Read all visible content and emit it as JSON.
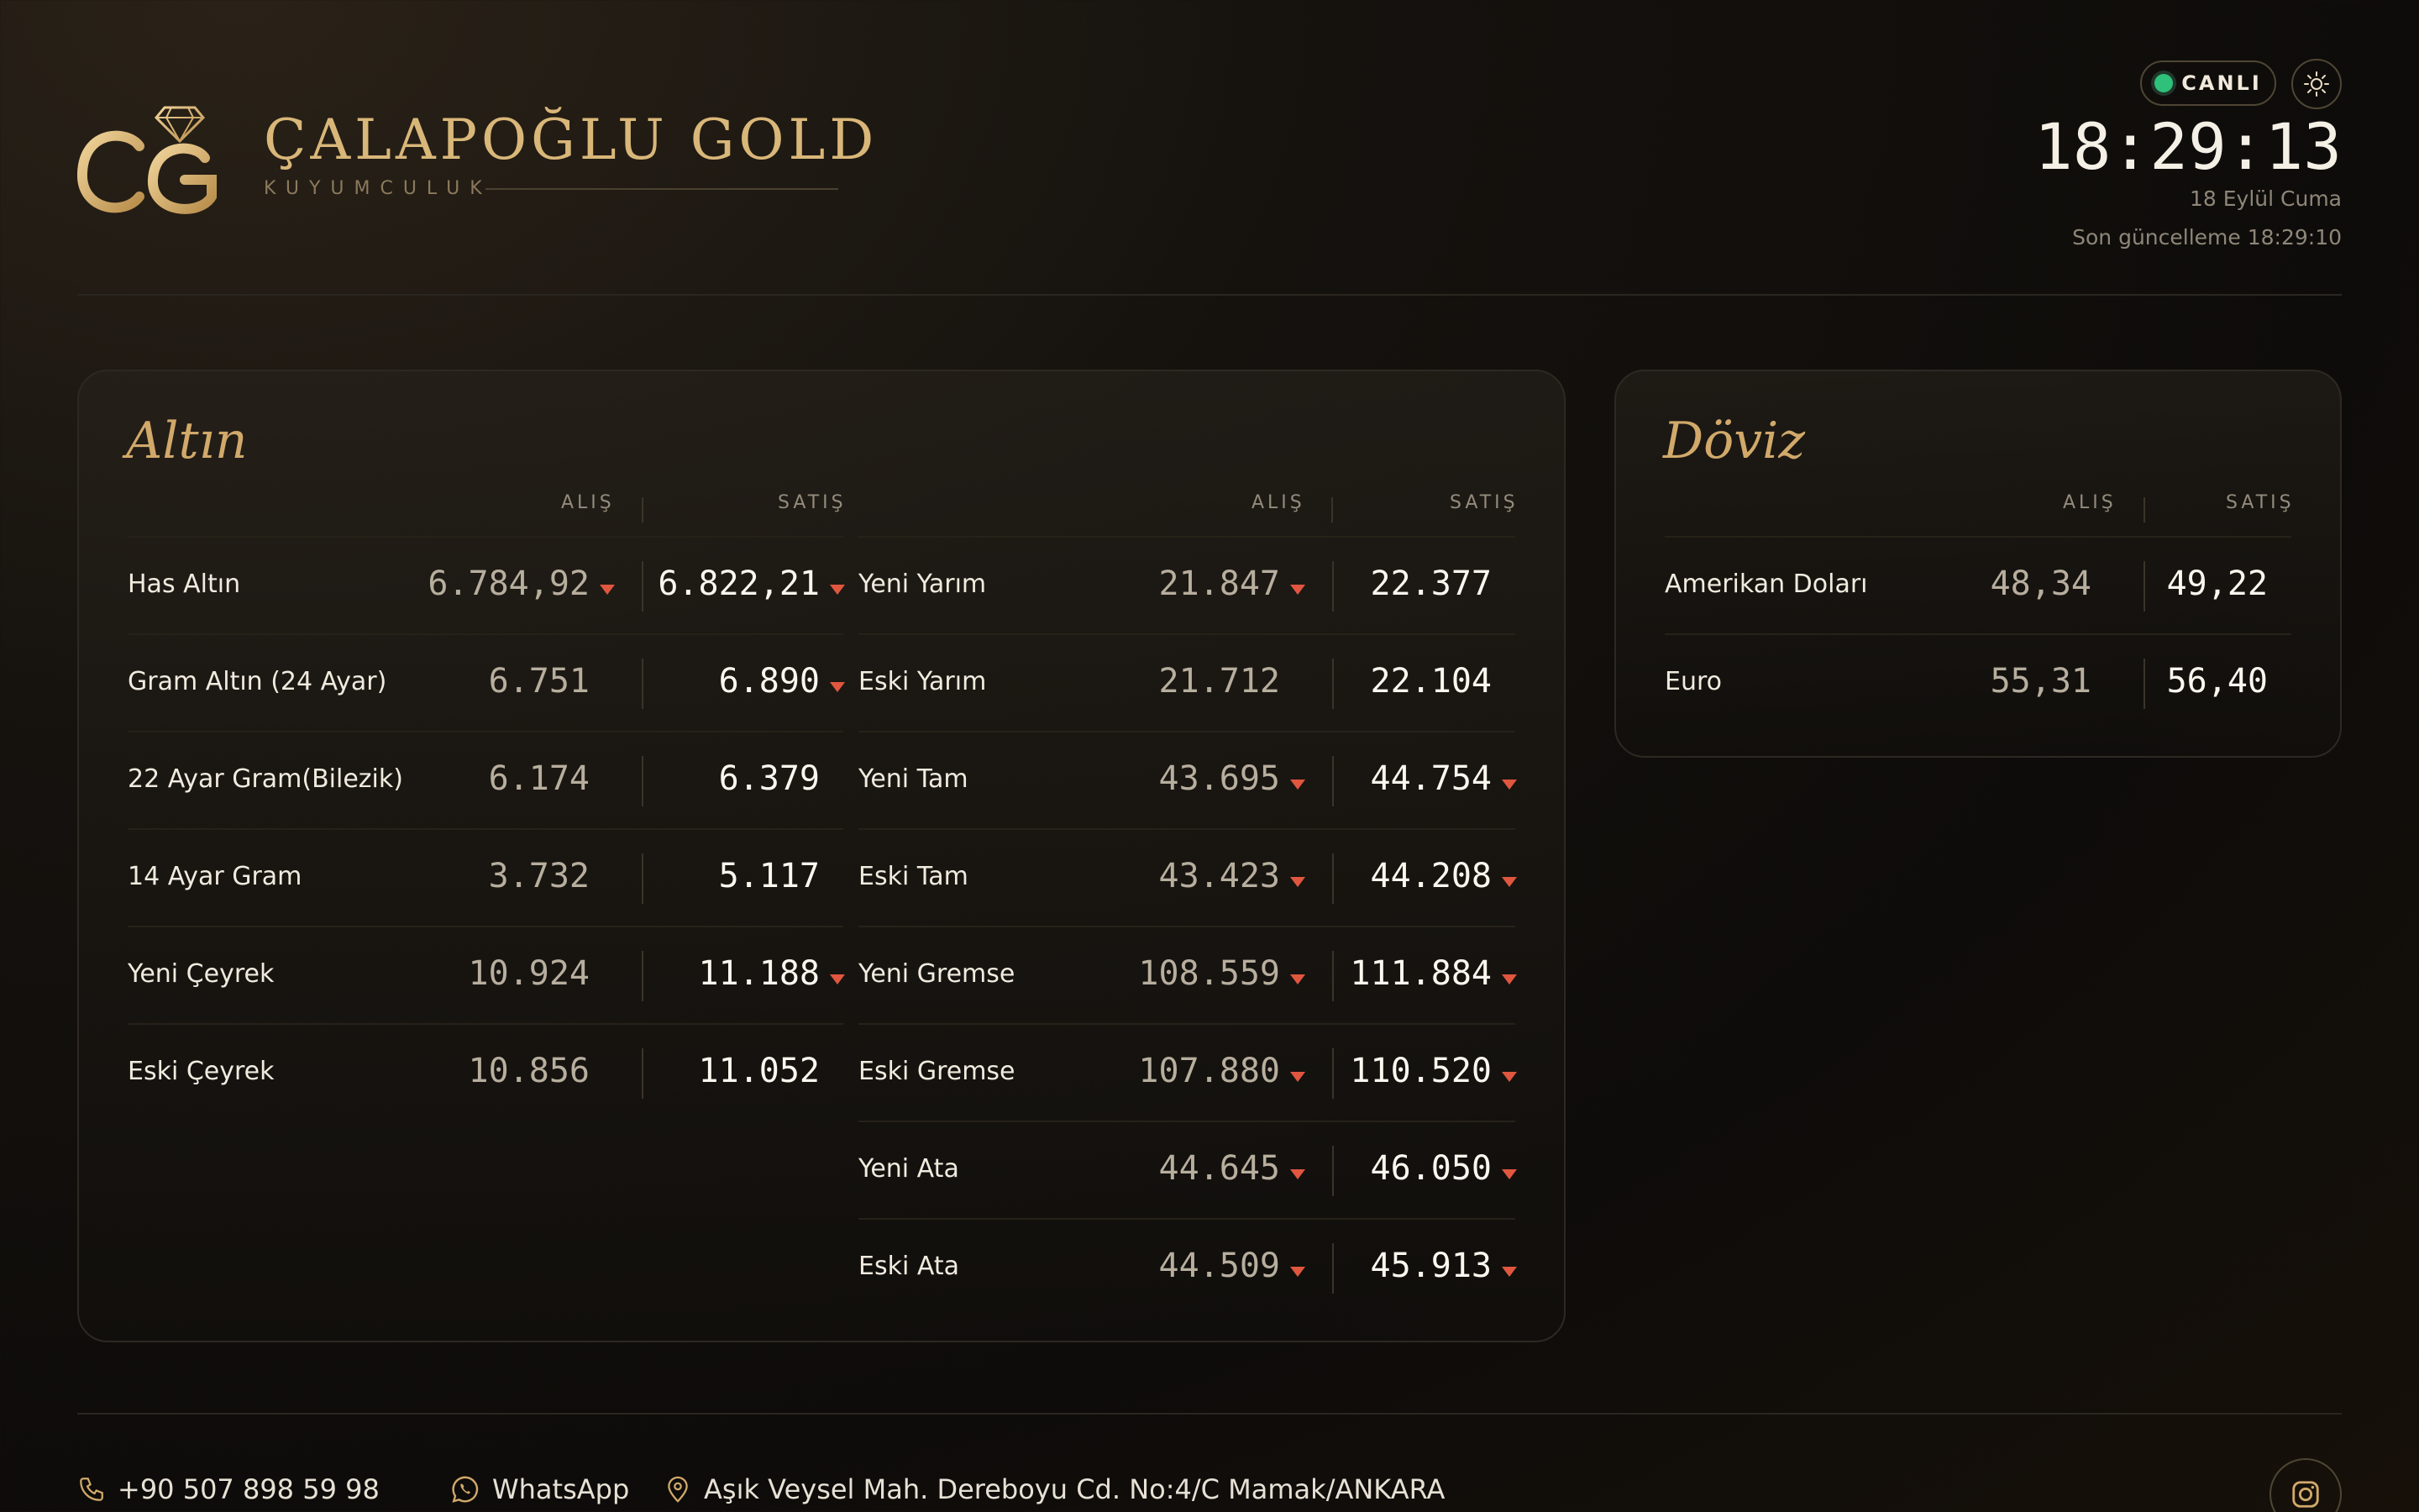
{
  "brand": {
    "name": "ÇALAPOĞLU GOLD",
    "subtitle": "KUYUMCULUK",
    "logo_letters": "CG"
  },
  "status": {
    "live_label": "CANLI",
    "time": "18:29:13",
    "date": "18 Eylül Cuma",
    "last_update": "Son güncelleme 18:29:10"
  },
  "gold": {
    "title": "Altın",
    "buy_label": "ALIŞ",
    "sell_label": "SATIŞ",
    "left": [
      {
        "name": "Has Altın",
        "buy": "6.784,92",
        "sell": "6.822,21",
        "buy_down": true,
        "sell_down": true
      },
      {
        "name": "Gram Altın (24 Ayar)",
        "buy": "6.751",
        "sell": "6.890",
        "buy_down": false,
        "sell_down": true
      },
      {
        "name": "22 Ayar Gram(Bilezik)",
        "buy": "6.174",
        "sell": "6.379",
        "buy_down": false,
        "sell_down": false
      },
      {
        "name": "14 Ayar Gram",
        "buy": "3.732",
        "sell": "5.117",
        "buy_down": false,
        "sell_down": false
      },
      {
        "name": "Yeni Çeyrek",
        "buy": "10.924",
        "sell": "11.188",
        "buy_down": false,
        "sell_down": true
      },
      {
        "name": "Eski Çeyrek",
        "buy": "10.856",
        "sell": "11.052",
        "buy_down": false,
        "sell_down": false
      }
    ],
    "right": [
      {
        "name": "Yeni Yarım",
        "buy": "21.847",
        "sell": "22.377",
        "buy_down": true,
        "sell_down": false
      },
      {
        "name": "Eski Yarım",
        "buy": "21.712",
        "sell": "22.104",
        "buy_down": false,
        "sell_down": false
      },
      {
        "name": "Yeni Tam",
        "buy": "43.695",
        "sell": "44.754",
        "buy_down": true,
        "sell_down": true
      },
      {
        "name": "Eski Tam",
        "buy": "43.423",
        "sell": "44.208",
        "buy_down": true,
        "sell_down": true
      },
      {
        "name": "Yeni Gremse",
        "buy": "108.559",
        "sell": "111.884",
        "buy_down": true,
        "sell_down": true
      },
      {
        "name": "Eski Gremse",
        "buy": "107.880",
        "sell": "110.520",
        "buy_down": true,
        "sell_down": true
      },
      {
        "name": "Yeni Ata",
        "buy": "44.645",
        "sell": "46.050",
        "buy_down": true,
        "sell_down": true
      },
      {
        "name": "Eski Ata",
        "buy": "44.509",
        "sell": "45.913",
        "buy_down": true,
        "sell_down": true
      }
    ]
  },
  "currency": {
    "title": "Döviz",
    "buy_label": "ALIŞ",
    "sell_label": "SATIŞ",
    "rows": [
      {
        "name": "Amerikan Doları",
        "buy": "48,34",
        "sell": "49,22"
      },
      {
        "name": "Euro",
        "buy": "55,31",
        "sell": "56,40"
      }
    ]
  },
  "footer": {
    "phone": "+90 507 898 59 98",
    "whatsapp": "WhatsApp",
    "address": "Aşık Veysel Mah. Dereboyu Cd. No:4/C Mamak/ANKARA"
  },
  "colors": {
    "accent": "#d9b779",
    "down": "#e0563f",
    "live": "#2fc07a"
  },
  "icons": [
    "diamond-icon",
    "sun-icon",
    "phone-icon",
    "whatsapp-icon",
    "location-pin-icon",
    "instagram-icon"
  ]
}
